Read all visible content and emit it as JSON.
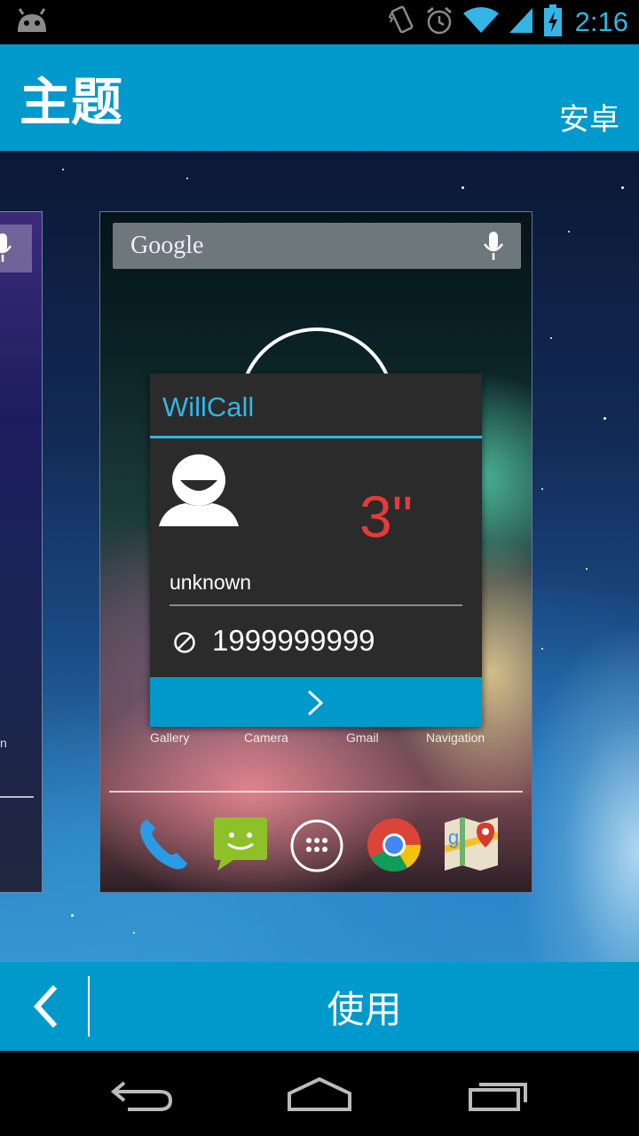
{
  "status_bar": {
    "time": "2:16",
    "icons": [
      "android-debug-icon",
      "vibrate-icon",
      "alarm-icon",
      "wifi-icon",
      "signal-icon",
      "battery-charging-icon"
    ]
  },
  "header": {
    "title": "主题",
    "theme_name": "安卓"
  },
  "preview": {
    "search_logo": "Google",
    "apps": [
      "Gallery",
      "Camera",
      "Gmail",
      "Navigation"
    ],
    "dock_icons": [
      "phone-icon",
      "messaging-icon",
      "app-drawer-icon",
      "chrome-icon",
      "maps-icon"
    ]
  },
  "dialog": {
    "app_name": "WillCall",
    "timer": "3\"",
    "caller_name": "unknown",
    "caller_number": "1999999999"
  },
  "action_bar": {
    "apply_label": "使用"
  },
  "colors": {
    "accent": "#0099cc",
    "holo_blue": "#33b5e5",
    "timer_red": "#e63a3a"
  }
}
